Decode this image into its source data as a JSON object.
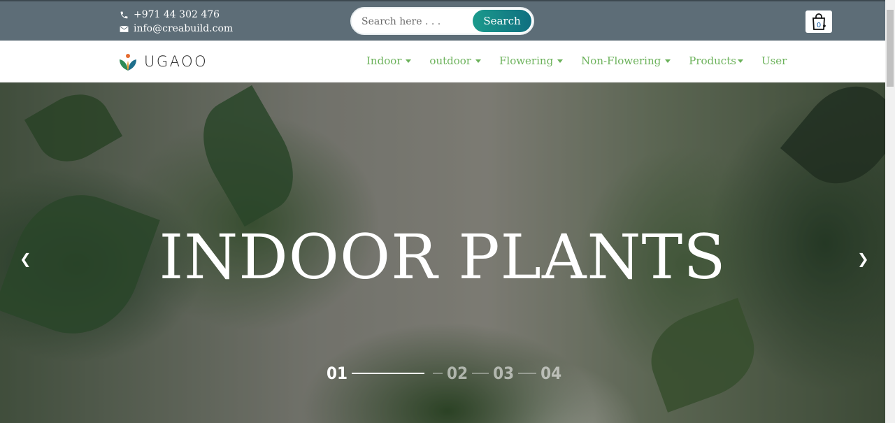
{
  "topbar": {
    "phone": "+971 44 302 476",
    "email": "info@creabuild.com",
    "search_placeholder": "Search here . . .",
    "search_button": "Search",
    "cart_count": "0"
  },
  "nav": {
    "logo_text": "UGAOO",
    "items": [
      {
        "label": "Indoor",
        "dropdown": true
      },
      {
        "label": "outdoor",
        "dropdown": true
      },
      {
        "label": "Flowering",
        "dropdown": true
      },
      {
        "label": "Non-Flowering",
        "dropdown": true
      },
      {
        "label": "Products",
        "dropdown": true
      },
      {
        "label": "User",
        "dropdown": false
      }
    ]
  },
  "hero": {
    "title": "INDOOR PLANTS",
    "prev_icon": "chevron-left-icon",
    "next_icon": "chevron-right-icon",
    "slides": [
      "01",
      "02",
      "03",
      "04"
    ],
    "active_slide": "01"
  },
  "colors": {
    "topbar_bg": "#5d6d77",
    "nav_link": "#6bb25a",
    "search_button": "#1b9a8c"
  }
}
